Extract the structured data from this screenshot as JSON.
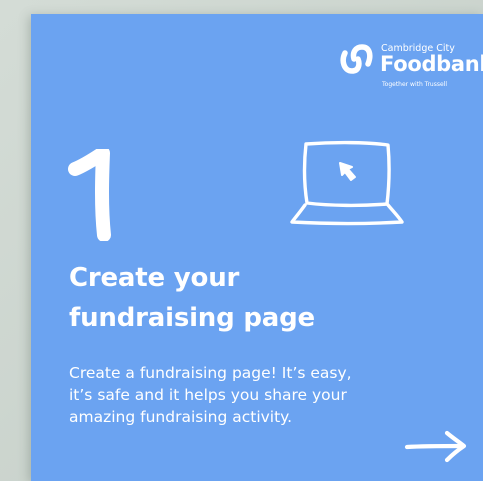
{
  "brand": {
    "line1": "Cambridge City",
    "name": "Foodbank",
    "tagline": "Together with Trussell"
  },
  "step": {
    "number": "1",
    "title_lines": [
      "Create your",
      "fundraising page"
    ],
    "description_lines": [
      "Create a fundraising page! It’s easy,",
      "it’s safe and it helps you share your",
      "amazing fundraising activity."
    ]
  },
  "icons": {
    "logo": "foodbank-logo-icon",
    "illustration": "laptop-cursor-icon",
    "next": "arrow-right-icon"
  },
  "colors": {
    "card_background": "#6ba3f1",
    "text": "#ffffff"
  }
}
